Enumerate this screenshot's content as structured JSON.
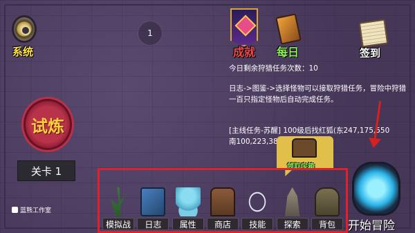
{
  "top": {
    "system_label": "系统",
    "circle_number": "1",
    "achievement_label": "成就",
    "daily_label": "每日",
    "sign_in_label": "签到"
  },
  "info": {
    "hunt_remaining": "今日剩余狩猎任务次数：10",
    "log_hint": "日志->图鉴->选择怪物可以接取狩猎任务，冒险中狩猎一百只指定怪物后自动完成任务。",
    "main_quest": "[主线任务-苏醒] 100级后找红狐(东247,175,550 南100,223,380)询问情况"
  },
  "left": {
    "trial_label": "试炼",
    "level_label": "关卡 1",
    "studio_label": "蓝熊工作室"
  },
  "chest_popup_label": "领取宝箱",
  "start_label": "开始冒险",
  "toolbar": [
    {
      "name": "simulate",
      "label": "模拟战",
      "icon": "plant-icon"
    },
    {
      "name": "log",
      "label": "日志",
      "icon": "book-icon"
    },
    {
      "name": "attributes",
      "label": "属性",
      "icon": "bear-icon"
    },
    {
      "name": "shop",
      "label": "商店",
      "icon": "chest-icon"
    },
    {
      "name": "skills",
      "label": "技能",
      "icon": "skill-icon"
    },
    {
      "name": "explore",
      "label": "探索",
      "icon": "rock-icon"
    },
    {
      "name": "backpack",
      "label": "背包",
      "icon": "bag-icon"
    }
  ],
  "colors": {
    "background": "#4d3c63",
    "highlight_red": "#e0202a",
    "label_yellow": "#ffe24a",
    "label_green": "#8ef05a"
  }
}
